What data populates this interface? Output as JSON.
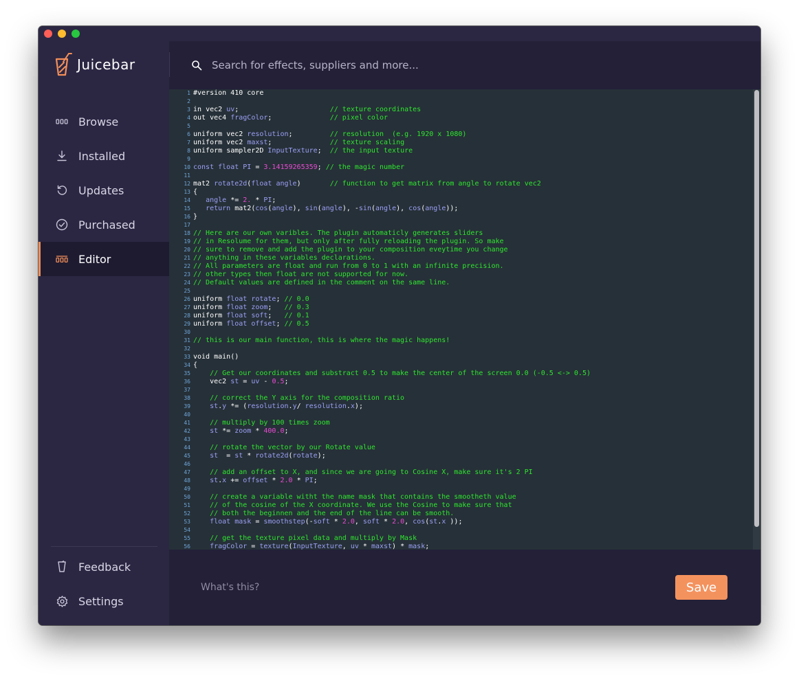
{
  "app": {
    "name": "Juicebar"
  },
  "search": {
    "placeholder": "Search for effects, suppliers and more..."
  },
  "sidebar": {
    "items": [
      {
        "label": "Browse",
        "icon": "grid-icon",
        "active": false
      },
      {
        "label": "Installed",
        "icon": "download-icon",
        "active": false
      },
      {
        "label": "Updates",
        "icon": "refresh-icon",
        "active": false
      },
      {
        "label": "Purchased",
        "icon": "check-circle-icon",
        "active": false
      },
      {
        "label": "Editor",
        "icon": "editor-icon",
        "active": true
      }
    ],
    "bottom_items": [
      {
        "label": "Feedback",
        "icon": "feedback-icon"
      },
      {
        "label": "Settings",
        "icon": "gear-icon"
      }
    ]
  },
  "editor": {
    "lines": [
      "#version 410 core",
      "",
      "in vec2 uv;                      // texture coordinates",
      "out vec4 fragColor;              // pixel color",
      "",
      "uniform vec2 resolution;         // resolution  (e.g. 1920 x 1080)",
      "uniform vec2 maxst;              // texture scaling",
      "uniform sampler2D InputTexture;  // the input texture",
      "",
      "const float PI = 3.14159265359; // the magic number",
      "",
      "mat2 rotate2d(float angle)       // function to get matrix from angle to rotate vec2",
      "{",
      "   angle *= 2. * PI;",
      "   return mat2(cos(angle), sin(angle), -sin(angle), cos(angle));",
      "}",
      "",
      "// Here are our own varibles. The plugin automaticly generates sliders",
      "// in Resolume for them, but only after fully reloading the plugin. So make",
      "// sure to remove and add the plugin to your composition eveytime you change",
      "// anything in these variables declarations.",
      "// All parameters are float and run from 0 to 1 with an infinite precision.",
      "// other types then float are not supported for now.",
      "// Default values are defined in the comment on the same line.",
      "",
      "uniform float rotate; // 0.0",
      "uniform float zoom;   // 0.3",
      "uniform float soft;   // 0.1",
      "uniform float offset; // 0.5",
      "",
      "// this is our main function, this is where the magic happens!",
      "",
      "void main()",
      "{",
      "    // Get our coordinates and substract 0.5 to make the center of the screen 0.0 (-0.5 <-> 0.5)",
      "    vec2 st = uv - 0.5;",
      "",
      "    // correct the Y axis for the composition ratio",
      "    st.y *= (resolution.y/ resolution.x);",
      "",
      "    // multiply by 100 times zoom",
      "    st *= zoom * 400.0;",
      "",
      "    // rotate the vector by our Rotate value",
      "    st  = st * rotate2d(rotate);",
      "",
      "    // add an offset to X, and since we are going to Cosine X, make sure it's 2 PI",
      "    st.x += offset * 2.0 * PI;",
      "",
      "    // create a variable witht the name mask that contains the smootheth value",
      "    // of the cosine of the X coordinate. We use the Cosine to make sure that",
      "    // both the beginnen and the end of the line can be smooth.",
      "    float mask = smoothstep(-soft * 2.0, soft * 2.0, cos(st.x ));",
      "",
      "    // get the texture pixel data and multiply by Mask",
      "    fragColor = texture(InputTexture, uv * maxst) * mask;"
    ]
  },
  "footer": {
    "help_link": "What's this?",
    "save_label": "Save"
  },
  "colors": {
    "accent": "#f4905a",
    "background": "#232038",
    "sidebar": "#2b2743",
    "editor_bg": "#263038",
    "keyword": "#9ba0f5",
    "comment": "#2fe62f",
    "number": "#ea4bd4",
    "line_number": "#6fa6d8"
  }
}
